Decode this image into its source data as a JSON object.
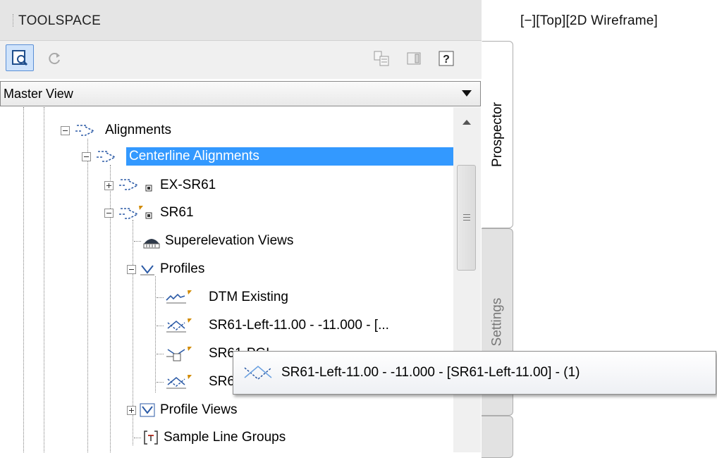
{
  "titlebar": {
    "title": "TOOLSPACE"
  },
  "viewport": {
    "label": "[−][Top][2D Wireframe]"
  },
  "toolbar": {
    "buttons": [
      {
        "name": "prospector-view-icon",
        "active": true
      },
      {
        "name": "refresh-icon",
        "active": false
      },
      {
        "name": "copy-settings-icon",
        "active": false
      },
      {
        "name": "item-view-icon",
        "active": false
      },
      {
        "name": "help-icon",
        "label": "?"
      }
    ]
  },
  "combo": {
    "value": "Master View"
  },
  "tree": {
    "items": [
      {
        "label": "Alignments",
        "icon": "alignment-collection-icon",
        "expanded": true
      },
      {
        "label": "Centerline Alignments",
        "icon": "alignment-collection-icon",
        "expanded": true,
        "selected": true
      },
      {
        "label": "EX-SR61",
        "icon": "alignment-icon",
        "expanded": false
      },
      {
        "label": "SR61",
        "icon": "alignment-out-of-date-icon",
        "expanded": true
      },
      {
        "label": "Superelevation Views",
        "icon": "superelevation-views-icon"
      },
      {
        "label": "Profiles",
        "icon": "profiles-icon",
        "expanded": true
      },
      {
        "label": "DTM Existing",
        "icon": "surface-profile-icon"
      },
      {
        "label": "SR61-Left-11.00 - -11.000 - [...",
        "icon": "offset-profile-icon"
      },
      {
        "label": "SR61-PGL",
        "icon": "layout-profile-icon"
      },
      {
        "label": "SR61-Right-11.00",
        "icon": "offset-profile-icon"
      },
      {
        "label": "Profile Views",
        "icon": "profile-views-icon",
        "expanded": false
      },
      {
        "label": "Sample Line Groups",
        "icon": "sample-line-groups-icon"
      }
    ]
  },
  "tabs": {
    "prospector": "Prospector",
    "settings": "Settings"
  },
  "tooltip": {
    "text": "SR61-Left-11.00 - -11.000 - [SR61-Left-11.00] -  (1)"
  },
  "colors": {
    "selection": "#3399ff",
    "titlebar": "#e5e5e5",
    "toolbar": "#f0f0f0"
  }
}
